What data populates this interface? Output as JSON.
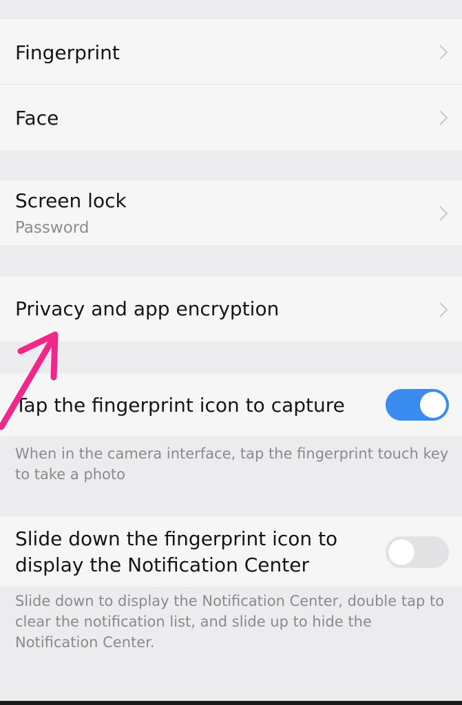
{
  "settings": {
    "items": [
      {
        "title": "Fingerprint"
      },
      {
        "title": "Face"
      },
      {
        "title": "Screen lock",
        "subtitle": "Password"
      },
      {
        "title": "Privacy and app encryption"
      }
    ],
    "toggles": [
      {
        "title": "Tap the fingerprint icon to capture",
        "state": "on",
        "description": "When in the camera interface, tap the fingerprint touch key to take a photo"
      },
      {
        "title_line1": "Slide down the fingerprint icon to",
        "title_line2": "display the Notification Center",
        "state": "off",
        "description": "Slide down to display the Notification Center, double tap to clear the notification list, and slide up to hide the Notification Center."
      }
    ]
  },
  "colors": {
    "toggle_on": "#3b8cf0",
    "annotation_arrow": "#f0288c"
  },
  "icons": {
    "chevron": "chevron-right-icon",
    "annotation": "arrow-annotation-icon"
  }
}
